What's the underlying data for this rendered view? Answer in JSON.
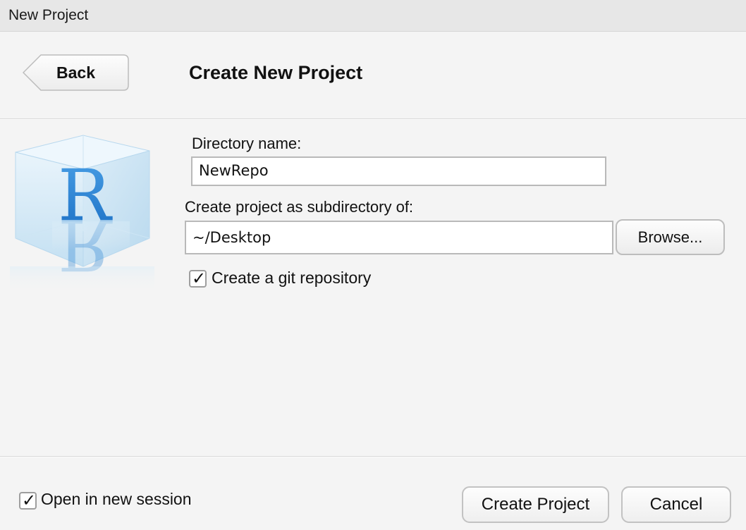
{
  "window": {
    "title": "New Project"
  },
  "header": {
    "back_label": "Back",
    "page_title": "Create New Project"
  },
  "form": {
    "directory_label": "Directory name:",
    "directory_value": "NewRepo",
    "subdirectory_label": "Create project as subdirectory of:",
    "subdirectory_value": "~/Desktop",
    "browse_label": "Browse...",
    "git_checkbox_label": "Create a git repository",
    "git_checked": true
  },
  "logo": {
    "letter": "R",
    "icon": "r-cube-logo"
  },
  "footer": {
    "session_checkbox_label": "Open in new session",
    "session_checked": true,
    "create_label": "Create Project",
    "cancel_label": "Cancel"
  },
  "colors": {
    "r_blue": "#1f78d1",
    "cube_tint": "#cfe6f6"
  }
}
